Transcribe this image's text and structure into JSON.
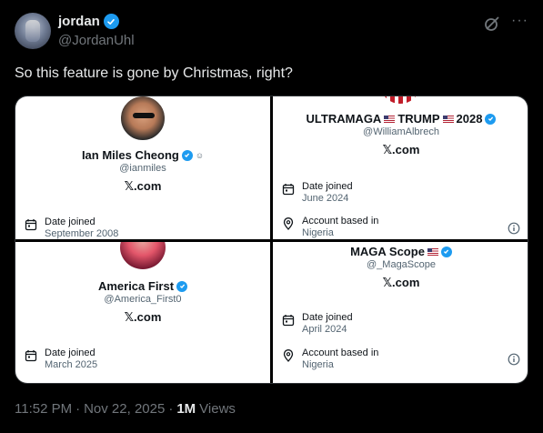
{
  "author": {
    "display_name": "jordan",
    "handle": "@JordanUhl"
  },
  "tweet": {
    "text": "So this feature is gone by Christmas, right?"
  },
  "cards": {
    "ian": {
      "name": "Ian Miles Cheong",
      "handle": "@ianmiles",
      "site": "𝕏.com",
      "date_label": "Date joined",
      "date_value": "September 2008"
    },
    "ultramaga": {
      "name_part1": "ULTRAMAGA",
      "name_part2": "TRUMP",
      "name_part3": "2028",
      "handle": "@WilliamAlbrech",
      "site": "𝕏.com",
      "date_label": "Date joined",
      "date_value": "June 2024",
      "location_label": "Account based in",
      "location_value": "Nigeria"
    },
    "america": {
      "name": "America First",
      "handle": "@America_First0",
      "site": "𝕏.com",
      "date_label": "Date joined",
      "date_value": "March 2025"
    },
    "magascope": {
      "name": "MAGA Scope",
      "handle": "@_MagaScope",
      "site": "𝕏.com",
      "date_label": "Date joined",
      "date_value": "April 2024",
      "location_label": "Account based in",
      "location_value": "Nigeria"
    }
  },
  "footer": {
    "time": "11:52 PM",
    "sep": "·",
    "date": "Nov 22, 2025",
    "sep2": "·",
    "views_count": "1M",
    "views_label": "Views"
  },
  "colors": {
    "accent": "#1d9bf0",
    "background": "#000000",
    "muted": "#71767b"
  },
  "icons": [
    "verified-badge-icon",
    "grok-icon",
    "more-icon",
    "calendar-icon",
    "location-pin-icon",
    "info-icon",
    "us-flag-icon"
  ]
}
